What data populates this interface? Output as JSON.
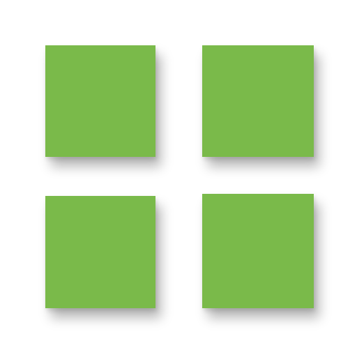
{
  "icon": {
    "name": "grid-view-icon",
    "tile_color": "#7aba4a",
    "background_color": "#ffffff",
    "tiles": [
      {
        "id": "top-left"
      },
      {
        "id": "top-right"
      },
      {
        "id": "bottom-left"
      },
      {
        "id": "bottom-right"
      }
    ]
  }
}
